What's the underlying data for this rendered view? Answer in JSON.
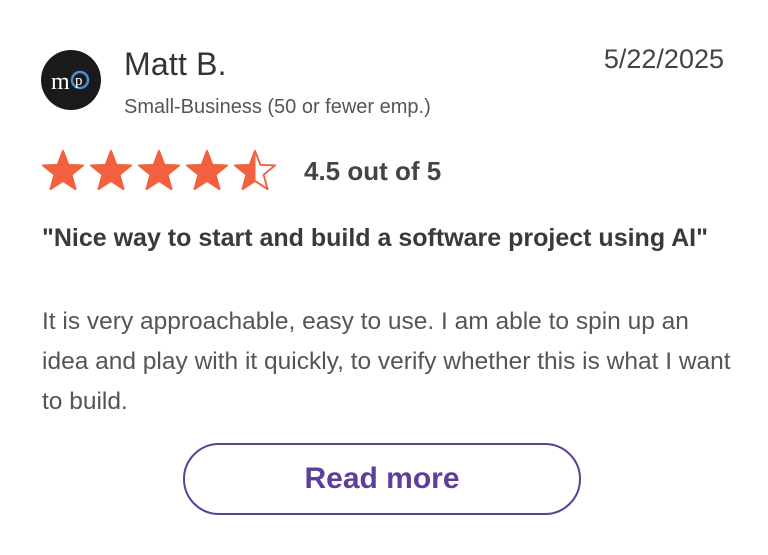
{
  "reviewer": {
    "avatar_icon": "mp-logo-icon",
    "name": "Matt B.",
    "segment": "Small-Business (50 or fewer emp.)"
  },
  "review": {
    "date": "5/22/2025",
    "rating": 4.5,
    "rating_max": 5,
    "rating_text": "4.5 out of 5",
    "title": "\"Nice way to start and build a software project using AI\"",
    "body": "It is very approachable, easy to use. I am able to spin up an idea and play with it quickly, to verify whether this is what I want to build."
  },
  "actions": {
    "read_more_label": "Read more"
  },
  "colors": {
    "star": "#f2613f",
    "button_accent": "#5b3f98",
    "avatar_bg": "#1a1a1a",
    "avatar_ring": "#4a90d9"
  }
}
